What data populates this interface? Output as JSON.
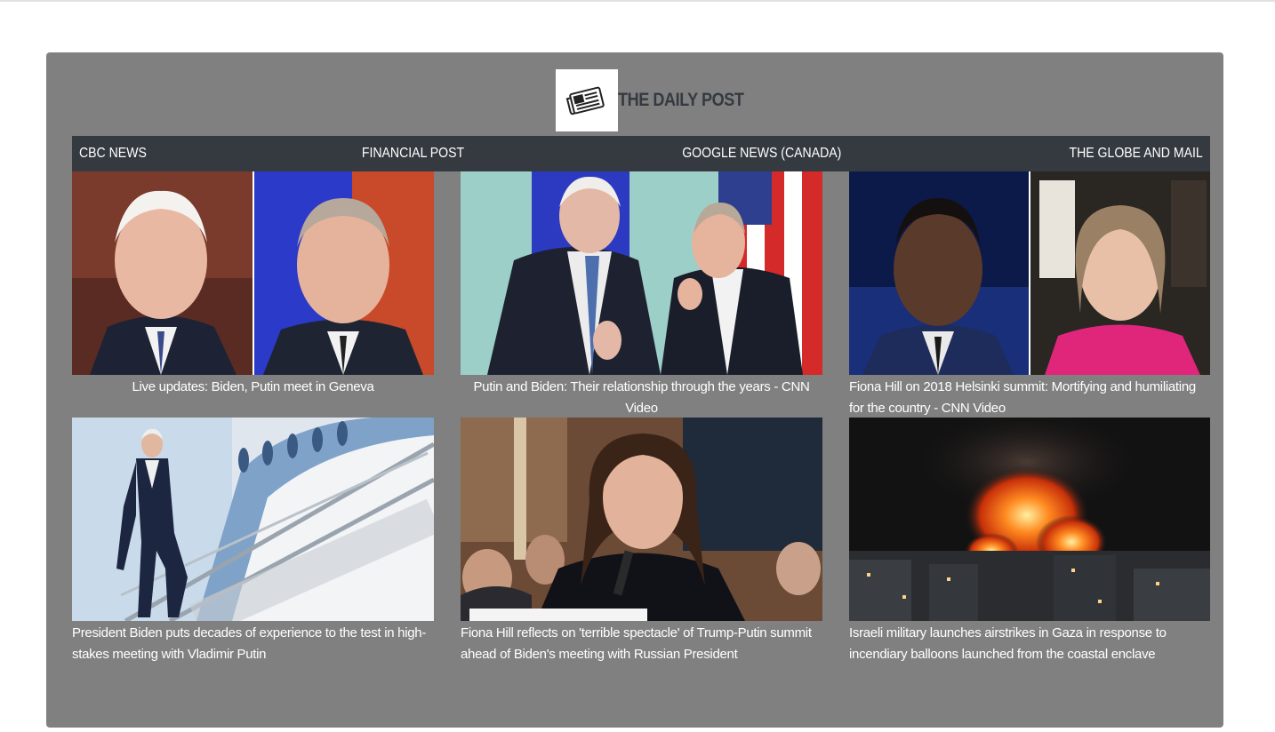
{
  "brand": {
    "title": "THE DAILY POST",
    "logo_icon": "newspaper-icon"
  },
  "nav": {
    "items": [
      {
        "label": "CBC NEWS"
      },
      {
        "label": "FINANCIAL POST"
      },
      {
        "label": "GOOGLE NEWS (CANADA)"
      },
      {
        "label": "THE GLOBE AND MAIL"
      }
    ]
  },
  "articles": [
    {
      "title": "Live updates: Biden, Putin meet in Geneva",
      "image": "biden-putin-split-portrait"
    },
    {
      "title": "Putin and Biden: Their relationship through the years - CNN Video",
      "image": "biden-putin-flags"
    },
    {
      "title": "Fiona Hill on 2018 Helsinki summit: Mortifying and humiliating for the country - CNN Video",
      "image": "anchor-and-guest-split"
    },
    {
      "title": "President Biden puts decades of experience to the test in high-stakes meeting with Vladimir Putin",
      "image": "biden-airplane-stairs"
    },
    {
      "title": "Fiona Hill reflects on 'terrible spectacle' of Trump-Putin summit ahead of Biden's meeting with Russian President",
      "image": "fiona-hill-testimony"
    },
    {
      "title": "Israeli military launches airstrikes in Gaza in response to incendiary balloons launched from the coastal enclave",
      "image": "gaza-night-airstrike"
    }
  ],
  "colors": {
    "panel": "#808080",
    "navbar": "#343a40",
    "brand_text": "#343a40"
  }
}
